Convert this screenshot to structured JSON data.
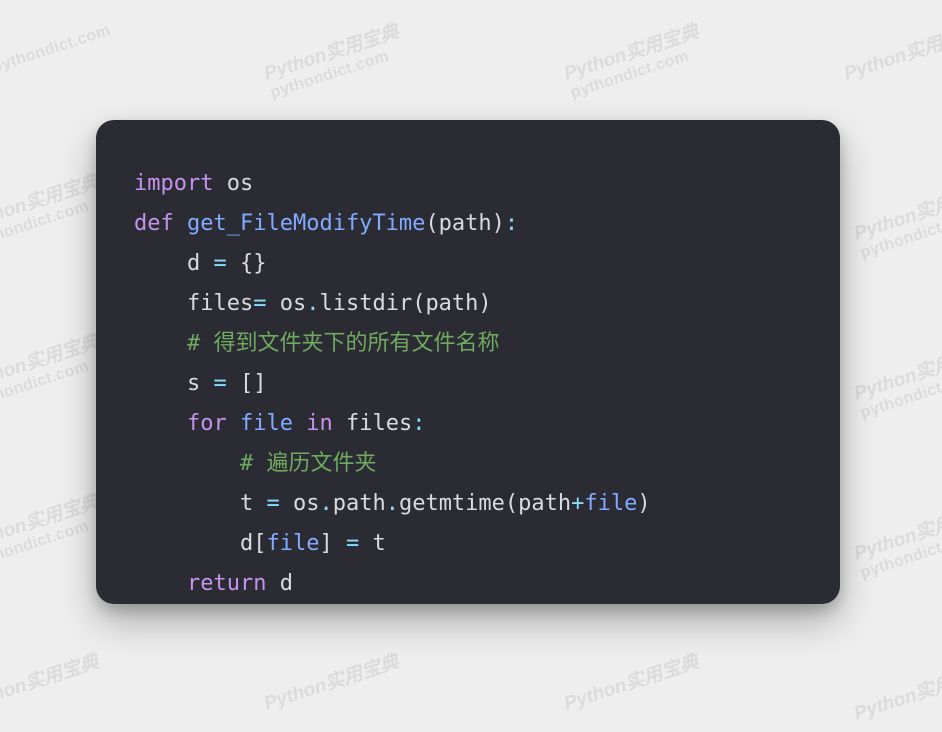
{
  "watermark": {
    "line1": "Python实用宝典",
    "line2": "pythondict.com"
  },
  "code": {
    "line1": {
      "kw": "import",
      "mod": "os"
    },
    "line2": {
      "kw": "def",
      "fn": "get_FileModifyTime",
      "lp": "(",
      "arg": "path",
      "rp": ")",
      "colon": ":"
    },
    "line3": {
      "pad": "    ",
      "lhs": "d",
      "eq": " = ",
      "rhs": "{}"
    },
    "line4": {
      "pad": "    ",
      "lhs": "files",
      "eq": "= ",
      "obj": "os",
      "dot": ".",
      "fn": "listdir",
      "lp": "(",
      "arg": "path",
      "rp": ")"
    },
    "line5": {
      "pad": "    ",
      "comment": "# 得到文件夹下的所有文件名称"
    },
    "line6": {
      "pad": "    ",
      "lhs": "s",
      "eq": " = ",
      "rhs": "[]"
    },
    "line7": {
      "pad": "    ",
      "kw_for": "for",
      "var": "file",
      "kw_in": "in",
      "iter": "files",
      "colon": ":"
    },
    "line8": {
      "pad": "        ",
      "comment": "# 遍历文件夹"
    },
    "line9": {
      "pad": "        ",
      "lhs": "t",
      "eq": " = ",
      "obj": "os",
      "dot1": ".",
      "p1": "path",
      "dot2": ".",
      "fn": "getmtime",
      "lp": "(",
      "arg1": "path",
      "plus": "+",
      "arg2": "file",
      "rp": ")"
    },
    "line10": {
      "pad": "        ",
      "lhs": "d",
      "lbr": "[",
      "key": "file",
      "rbr": "]",
      "eq": " = ",
      "rhs": "t"
    },
    "line11": {
      "pad": "    ",
      "kw": "return",
      "val": " d"
    }
  }
}
